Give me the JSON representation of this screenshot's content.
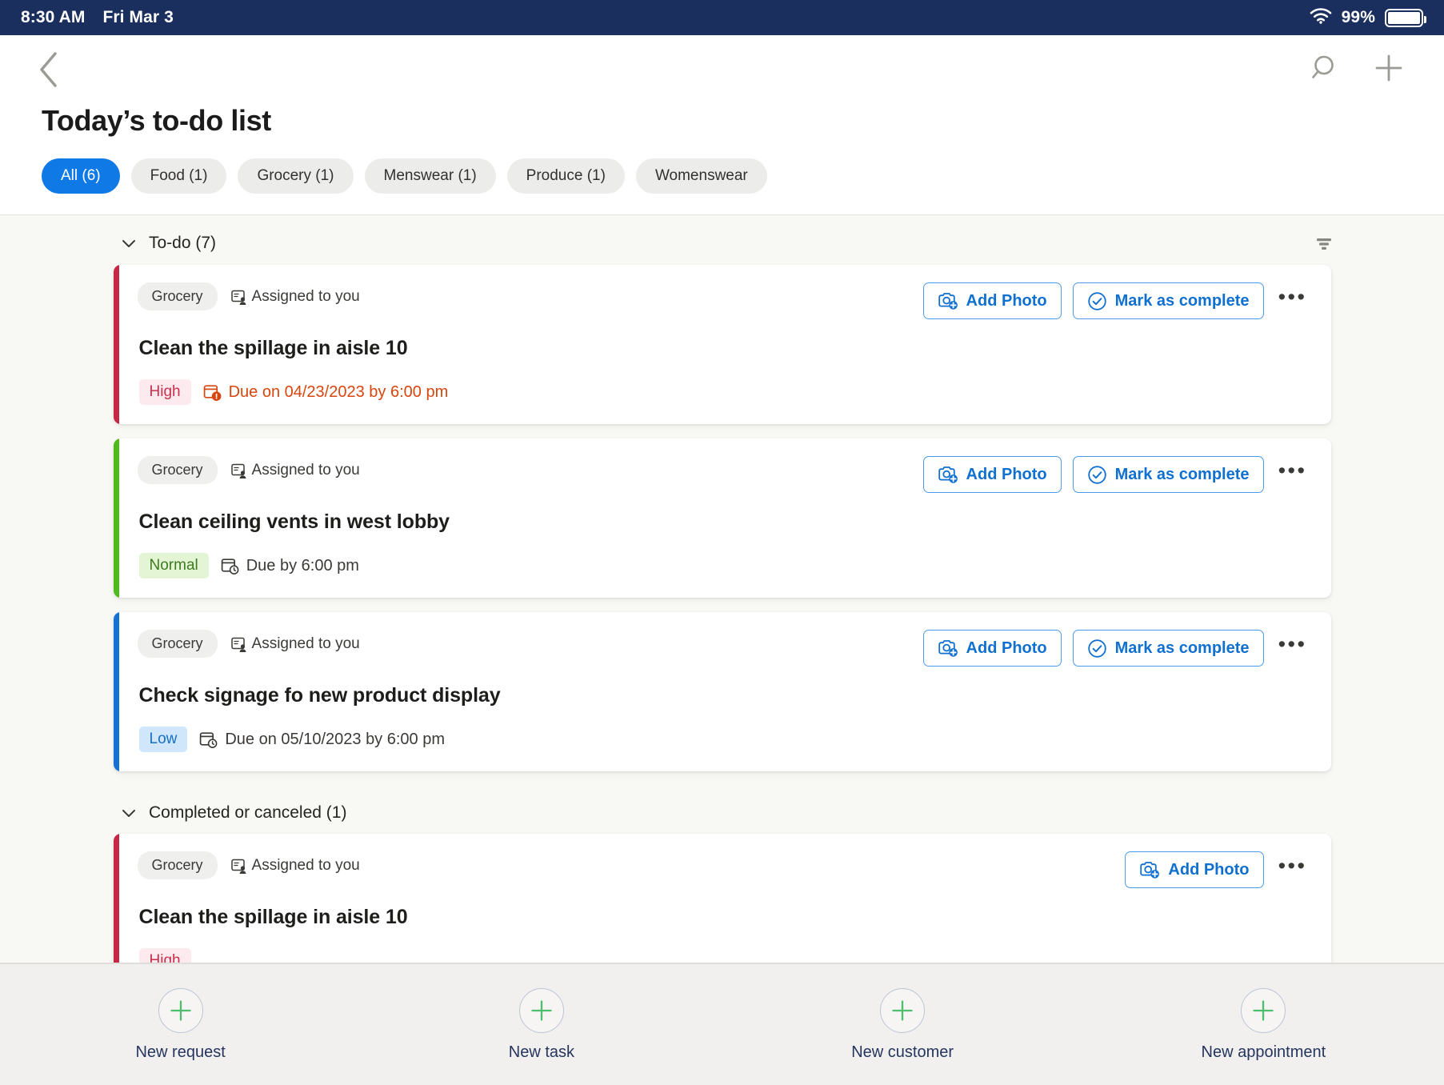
{
  "statusbar": {
    "time": "8:30 AM",
    "date": "Fri Mar 3",
    "battery_percent": "99%",
    "wifi_icon": "wifi-icon",
    "battery_icon": "battery-icon"
  },
  "header": {
    "back_icon": "chevron-left-icon",
    "search_icon": "search-icon",
    "add_icon": "plus-icon",
    "title": "Today’s to-do list",
    "chips": [
      {
        "label": "All (6)",
        "active": true
      },
      {
        "label": "Food (1)",
        "active": false
      },
      {
        "label": "Grocery (1)",
        "active": false
      },
      {
        "label": "Menswear (1)",
        "active": false
      },
      {
        "label": "Produce (1)",
        "active": false
      },
      {
        "label": "Womenswear",
        "active": false
      }
    ]
  },
  "list": {
    "filter_icon": "filter-icon",
    "sections": [
      {
        "title": "To-do (7)",
        "caret_icon": "chevron-down-icon",
        "tasks": [
          {
            "accent": "#C62744",
            "tag": "Grocery",
            "assigned": "Assigned to you",
            "assigned_icon": "assigned-person-icon",
            "title": "Clean the spillage in aisle 10",
            "priority": "High",
            "priority_class": "high",
            "due": "Due on 04/23/2023 by 6:00 pm",
            "due_overdue": true,
            "due_icon": "calendar-alert-icon",
            "buttons": [
              {
                "label": "Add Photo",
                "icon": "camera-add-icon"
              },
              {
                "label": "Mark as complete",
                "icon": "check-circle-icon"
              }
            ],
            "more_icon": "more-horizontal-icon"
          },
          {
            "accent": "#4FBA1E",
            "tag": "Grocery",
            "assigned": "Assigned to you",
            "assigned_icon": "assigned-person-icon",
            "title": "Clean ceiling vents in west lobby",
            "priority": "Normal",
            "priority_class": "normal",
            "due": "Due by 6:00 pm",
            "due_overdue": false,
            "due_icon": "calendar-clock-icon",
            "buttons": [
              {
                "label": "Add Photo",
                "icon": "camera-add-icon"
              },
              {
                "label": "Mark as complete",
                "icon": "check-circle-icon"
              }
            ],
            "more_icon": "more-horizontal-icon"
          },
          {
            "accent": "#1572D3",
            "tag": "Grocery",
            "assigned": "Assigned to you",
            "assigned_icon": "assigned-person-icon",
            "title": "Check signage fo new product display",
            "priority": "Low",
            "priority_class": "low",
            "due": "Due on 05/10/2023 by 6:00 pm",
            "due_overdue": false,
            "due_icon": "calendar-clock-icon",
            "buttons": [
              {
                "label": "Add Photo",
                "icon": "camera-add-icon"
              },
              {
                "label": "Mark as complete",
                "icon": "check-circle-icon"
              }
            ],
            "more_icon": "more-horizontal-icon"
          }
        ]
      },
      {
        "title": "Completed or canceled (1)",
        "caret_icon": "chevron-down-icon",
        "tasks": [
          {
            "accent": "#C62744",
            "tag": "Grocery",
            "assigned": "Assigned to you",
            "assigned_icon": "assigned-person-icon",
            "title": "Clean the spillage in aisle 10",
            "priority": "High",
            "priority_class": "high",
            "due": "",
            "due_overdue": false,
            "due_icon": "",
            "buttons": [
              {
                "label": "Add Photo",
                "icon": "camera-add-icon"
              }
            ],
            "more_icon": "more-horizontal-icon"
          }
        ]
      }
    ]
  },
  "bottombar": {
    "items": [
      {
        "label": "New request",
        "icon": "plus-circle-icon"
      },
      {
        "label": "New task",
        "icon": "plus-circle-icon"
      },
      {
        "label": "New customer",
        "icon": "plus-circle-icon"
      },
      {
        "label": "New appointment",
        "icon": "plus-circle-icon"
      }
    ]
  },
  "colors": {
    "accent_blue": "#0f7ae5",
    "status_bar": "#1b2f5e",
    "high": "#C62744",
    "normal": "#4FBA1E",
    "low": "#1572D3",
    "overdue_text": "#d8450d",
    "plus_green": "#4CBE6C"
  }
}
